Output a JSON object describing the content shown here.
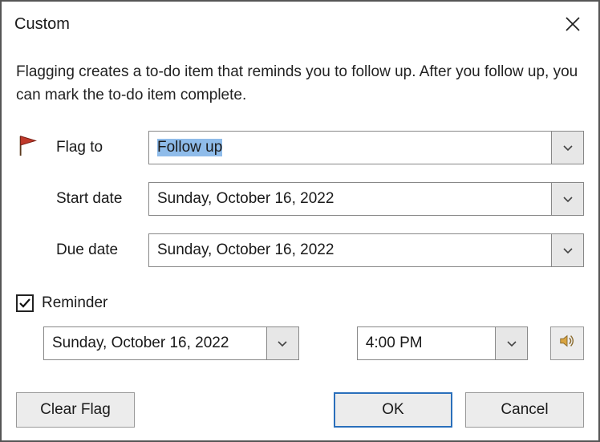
{
  "title": "Custom",
  "description": "Flagging creates a to-do item that reminds you to follow up. After you follow up, you can mark the to-do item complete.",
  "labels": {
    "flag_to": "Flag to",
    "start_date": "Start date",
    "due_date": "Due date",
    "reminder": "Reminder"
  },
  "fields": {
    "flag_to_value": "Follow up",
    "start_date_value": "Sunday, October 16, 2022",
    "due_date_value": "Sunday, October 16, 2022",
    "reminder_checked": true,
    "reminder_date_value": "Sunday, October 16, 2022",
    "reminder_time_value": "4:00 PM"
  },
  "buttons": {
    "clear_flag": "Clear Flag",
    "ok": "OK",
    "cancel": "Cancel"
  }
}
